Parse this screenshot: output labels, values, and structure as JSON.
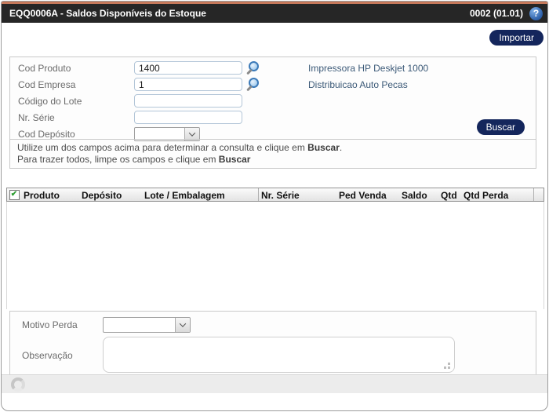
{
  "titlebar": {
    "title": "EQQ0006A - Saldos Disponíveis do Estoque",
    "code": "0002 (01.01)",
    "help": "?"
  },
  "toolbar": {
    "importar": "Importar"
  },
  "search_form": {
    "fields": [
      {
        "label": "Cod Produto",
        "value": "1400",
        "description": "Impressora HP Deskjet 1000"
      },
      {
        "label": "Cod Empresa",
        "value": "1",
        "description": "Distribuicao Auto Pecas"
      },
      {
        "label": "Código do Lote",
        "value": ""
      },
      {
        "label": "Nr. Série",
        "value": ""
      },
      {
        "label": "Cod Depósito",
        "value": ""
      }
    ],
    "buscar": "Buscar",
    "instructions": [
      {
        "text": "Utilize um dos campos acima para determinar a consulta e clique em ",
        "bold": "Buscar",
        "suffix": "."
      },
      {
        "text": "Para trazer todos, limpe os campos e clique em ",
        "bold": "Buscar",
        "suffix": ""
      }
    ]
  },
  "grid": {
    "columns": [
      "Produto",
      "Depósito",
      "Lote / Embalagem",
      "Nr. Série",
      "Ped Venda",
      "Saldo",
      "Qtd",
      "Qtd Perda"
    ],
    "select_all_checked": true,
    "rows": []
  },
  "loss_form": {
    "motivo_perda_label": "Motivo Perda",
    "motivo_perda_value": "",
    "observacao_label": "Observação",
    "observacao_value": ""
  },
  "icons": {
    "check": "✔"
  },
  "colors": {
    "accent_navy": "#14265c",
    "titlebar_bg": "#262626",
    "top_line": "#c6795b",
    "help_blue": "#2d5fa8",
    "link_text": "#3c5a78",
    "check_green": "#2f9e33"
  }
}
